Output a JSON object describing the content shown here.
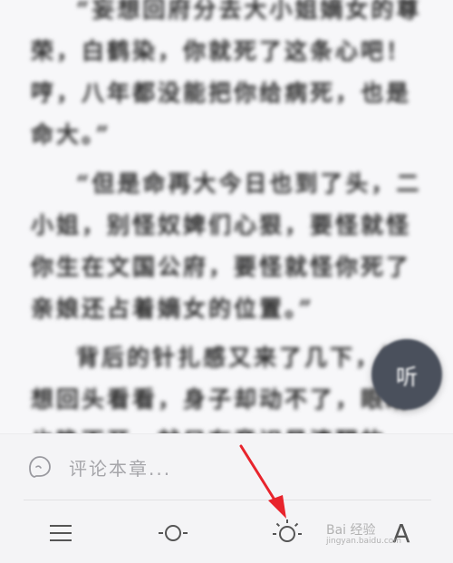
{
  "reader": {
    "paragraphs": [
      {
        "text": "“妄想回府分去大小姐嫡女的尊荣，白鹤染，你就死了这条心吧！哼，八年都没能把你给病死，也是命大。”",
        "indent": true
      },
      {
        "text": "“但是命再大今日也到了头，二小姐，别怪奴婢们心狠，要怪就怪你生在文国公府，要怪就怪你死了亲娘还占着嫡女的位置。”",
        "indent": true
      },
      {
        "text": "背后的针扎感又来了几下，她想回头看看，身子却动不了，眼睛也睁不开，就只有意识是清醒的。那两下",
        "indent": true
      }
    ],
    "listen_label": "听"
  },
  "comment": {
    "placeholder": "评论本章..."
  },
  "toolbar": {
    "font_label": "A"
  },
  "watermark": {
    "line1": "Bai 经验",
    "line2": "jingyan.baidu.com"
  },
  "colors": {
    "arrow": "#e8242c",
    "listen_bg": "#4a505c"
  }
}
